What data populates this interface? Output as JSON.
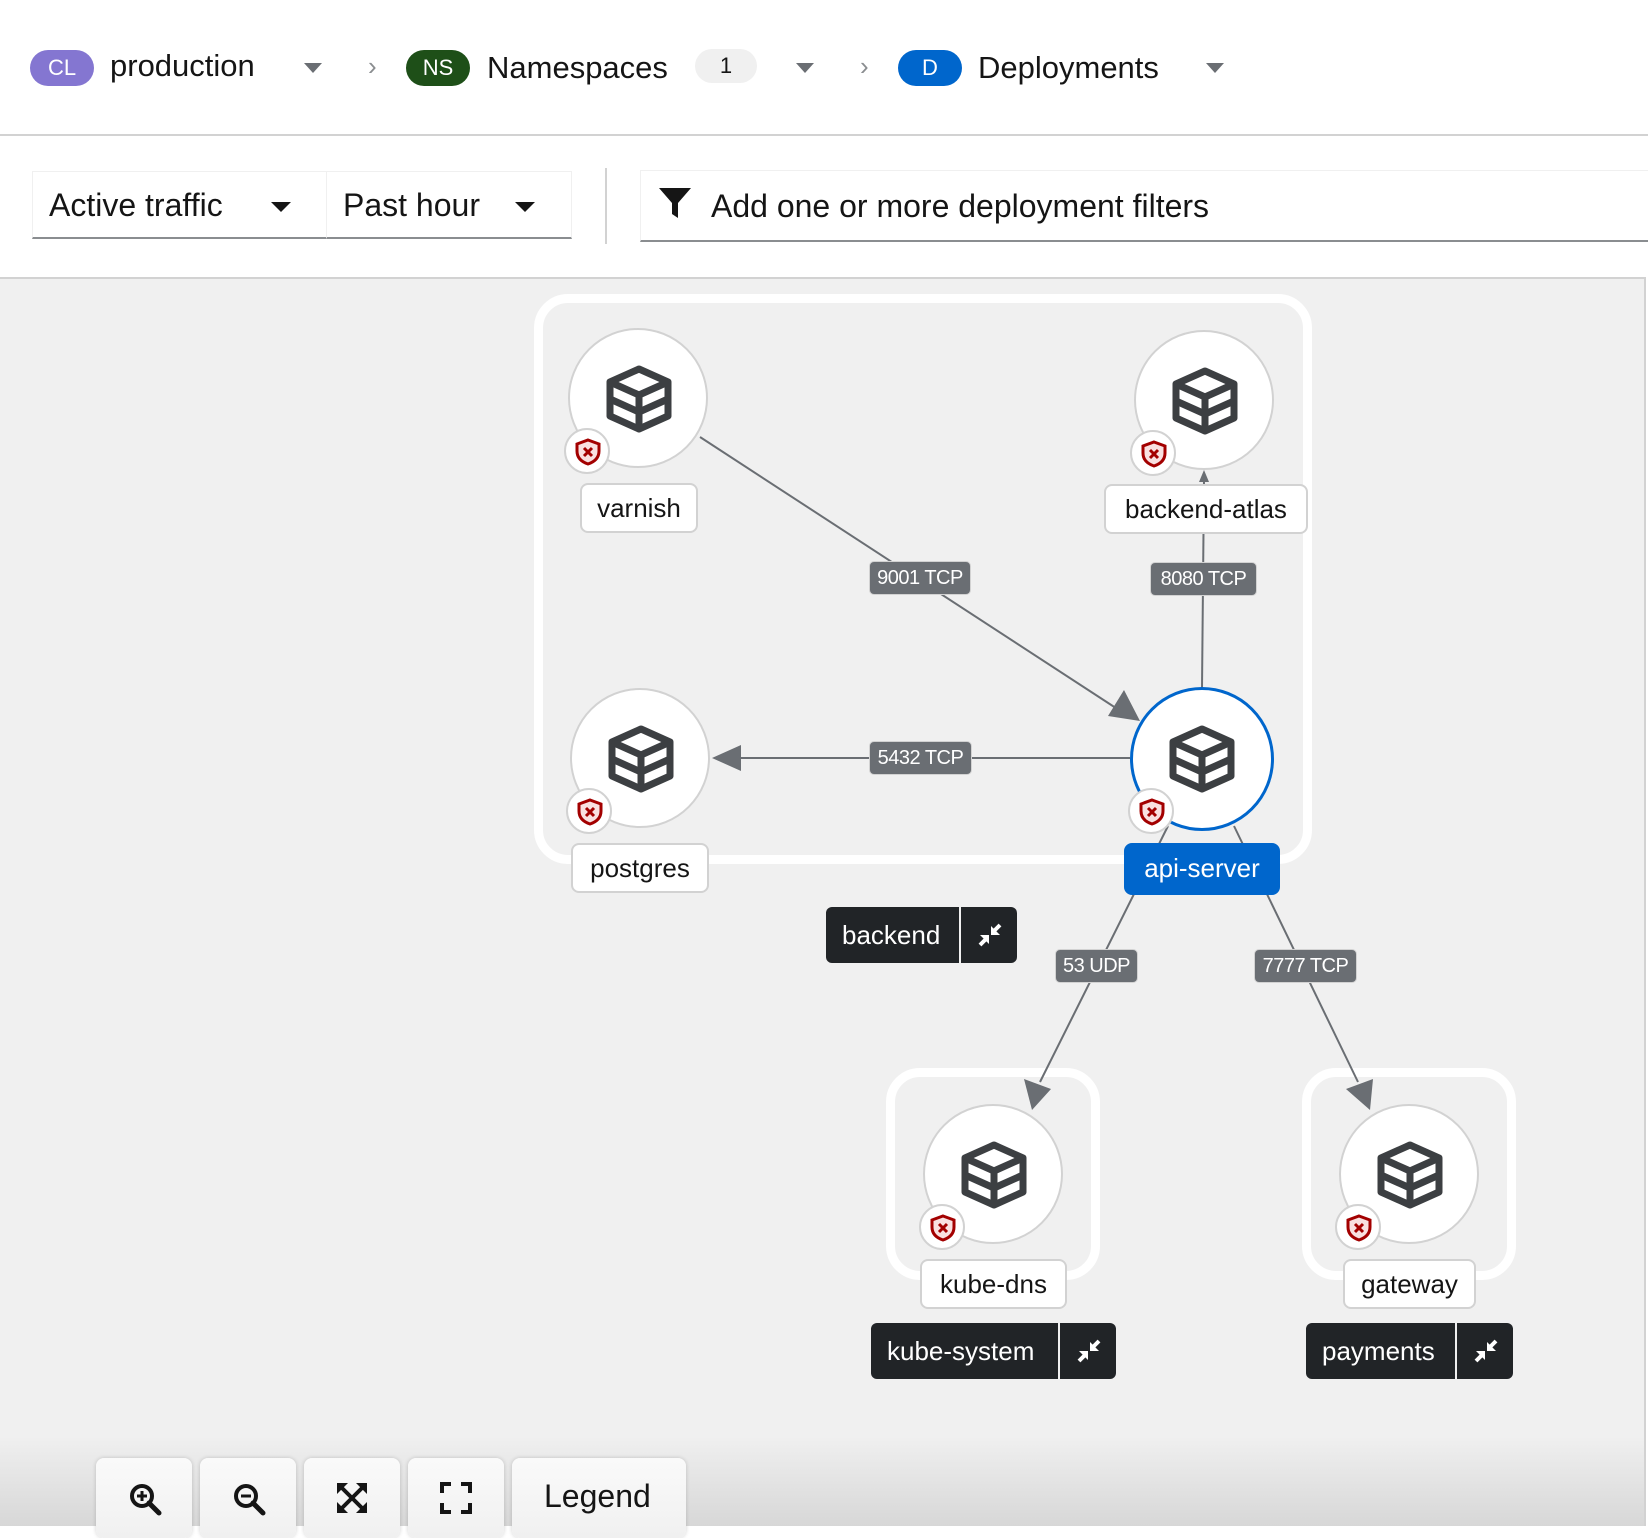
{
  "breadcrumb": {
    "cluster": {
      "badge": "CL",
      "label": "production",
      "badge_color": "#8476d1"
    },
    "namespaces": {
      "badge": "NS",
      "label": "Namespaces",
      "count": "1",
      "badge_color": "#1e4f18"
    },
    "deployments": {
      "badge": "D",
      "label": "Deployments",
      "badge_color": "#0066cc"
    }
  },
  "toolbar": {
    "traffic_select": "Active traffic",
    "time_select": "Past hour",
    "filter_placeholder": "Add one or more deployment filters"
  },
  "graph": {
    "groups": [
      {
        "id": "backend",
        "label": "backend"
      },
      {
        "id": "kube-system",
        "label": "kube-system"
      },
      {
        "id": "payments",
        "label": "payments"
      }
    ],
    "nodes": [
      {
        "id": "varnish",
        "label": "varnish",
        "group": "backend",
        "selected": false
      },
      {
        "id": "backend-atlas",
        "label": "backend-atlas",
        "group": "backend",
        "selected": false
      },
      {
        "id": "postgres",
        "label": "postgres",
        "group": "backend",
        "selected": false
      },
      {
        "id": "api-server",
        "label": "api-server",
        "group": "backend",
        "selected": true
      },
      {
        "id": "kube-dns",
        "label": "kube-dns",
        "group": "kube-system",
        "selected": false
      },
      {
        "id": "gateway",
        "label": "gateway",
        "group": "payments",
        "selected": false
      }
    ],
    "edges": [
      {
        "from": "varnish",
        "to": "api-server",
        "label": "9001 TCP"
      },
      {
        "from": "api-server",
        "to": "backend-atlas",
        "label": "8080 TCP"
      },
      {
        "from": "api-server",
        "to": "postgres",
        "label": "5432 TCP"
      },
      {
        "from": "api-server",
        "to": "kube-dns",
        "label": "53 UDP"
      },
      {
        "from": "api-server",
        "to": "gateway",
        "label": "7777 TCP"
      }
    ],
    "node_icon": "deployment-cube-icon",
    "policy_badge_icon": "shield-x-icon",
    "accent_color": "#0066cc",
    "policy_color": "#a30000"
  },
  "controls": {
    "zoom_in": "zoom-in-icon",
    "zoom_out": "zoom-out-icon",
    "fit": "fit-to-screen-icon",
    "reset": "reset-view-icon",
    "legend_label": "Legend"
  }
}
